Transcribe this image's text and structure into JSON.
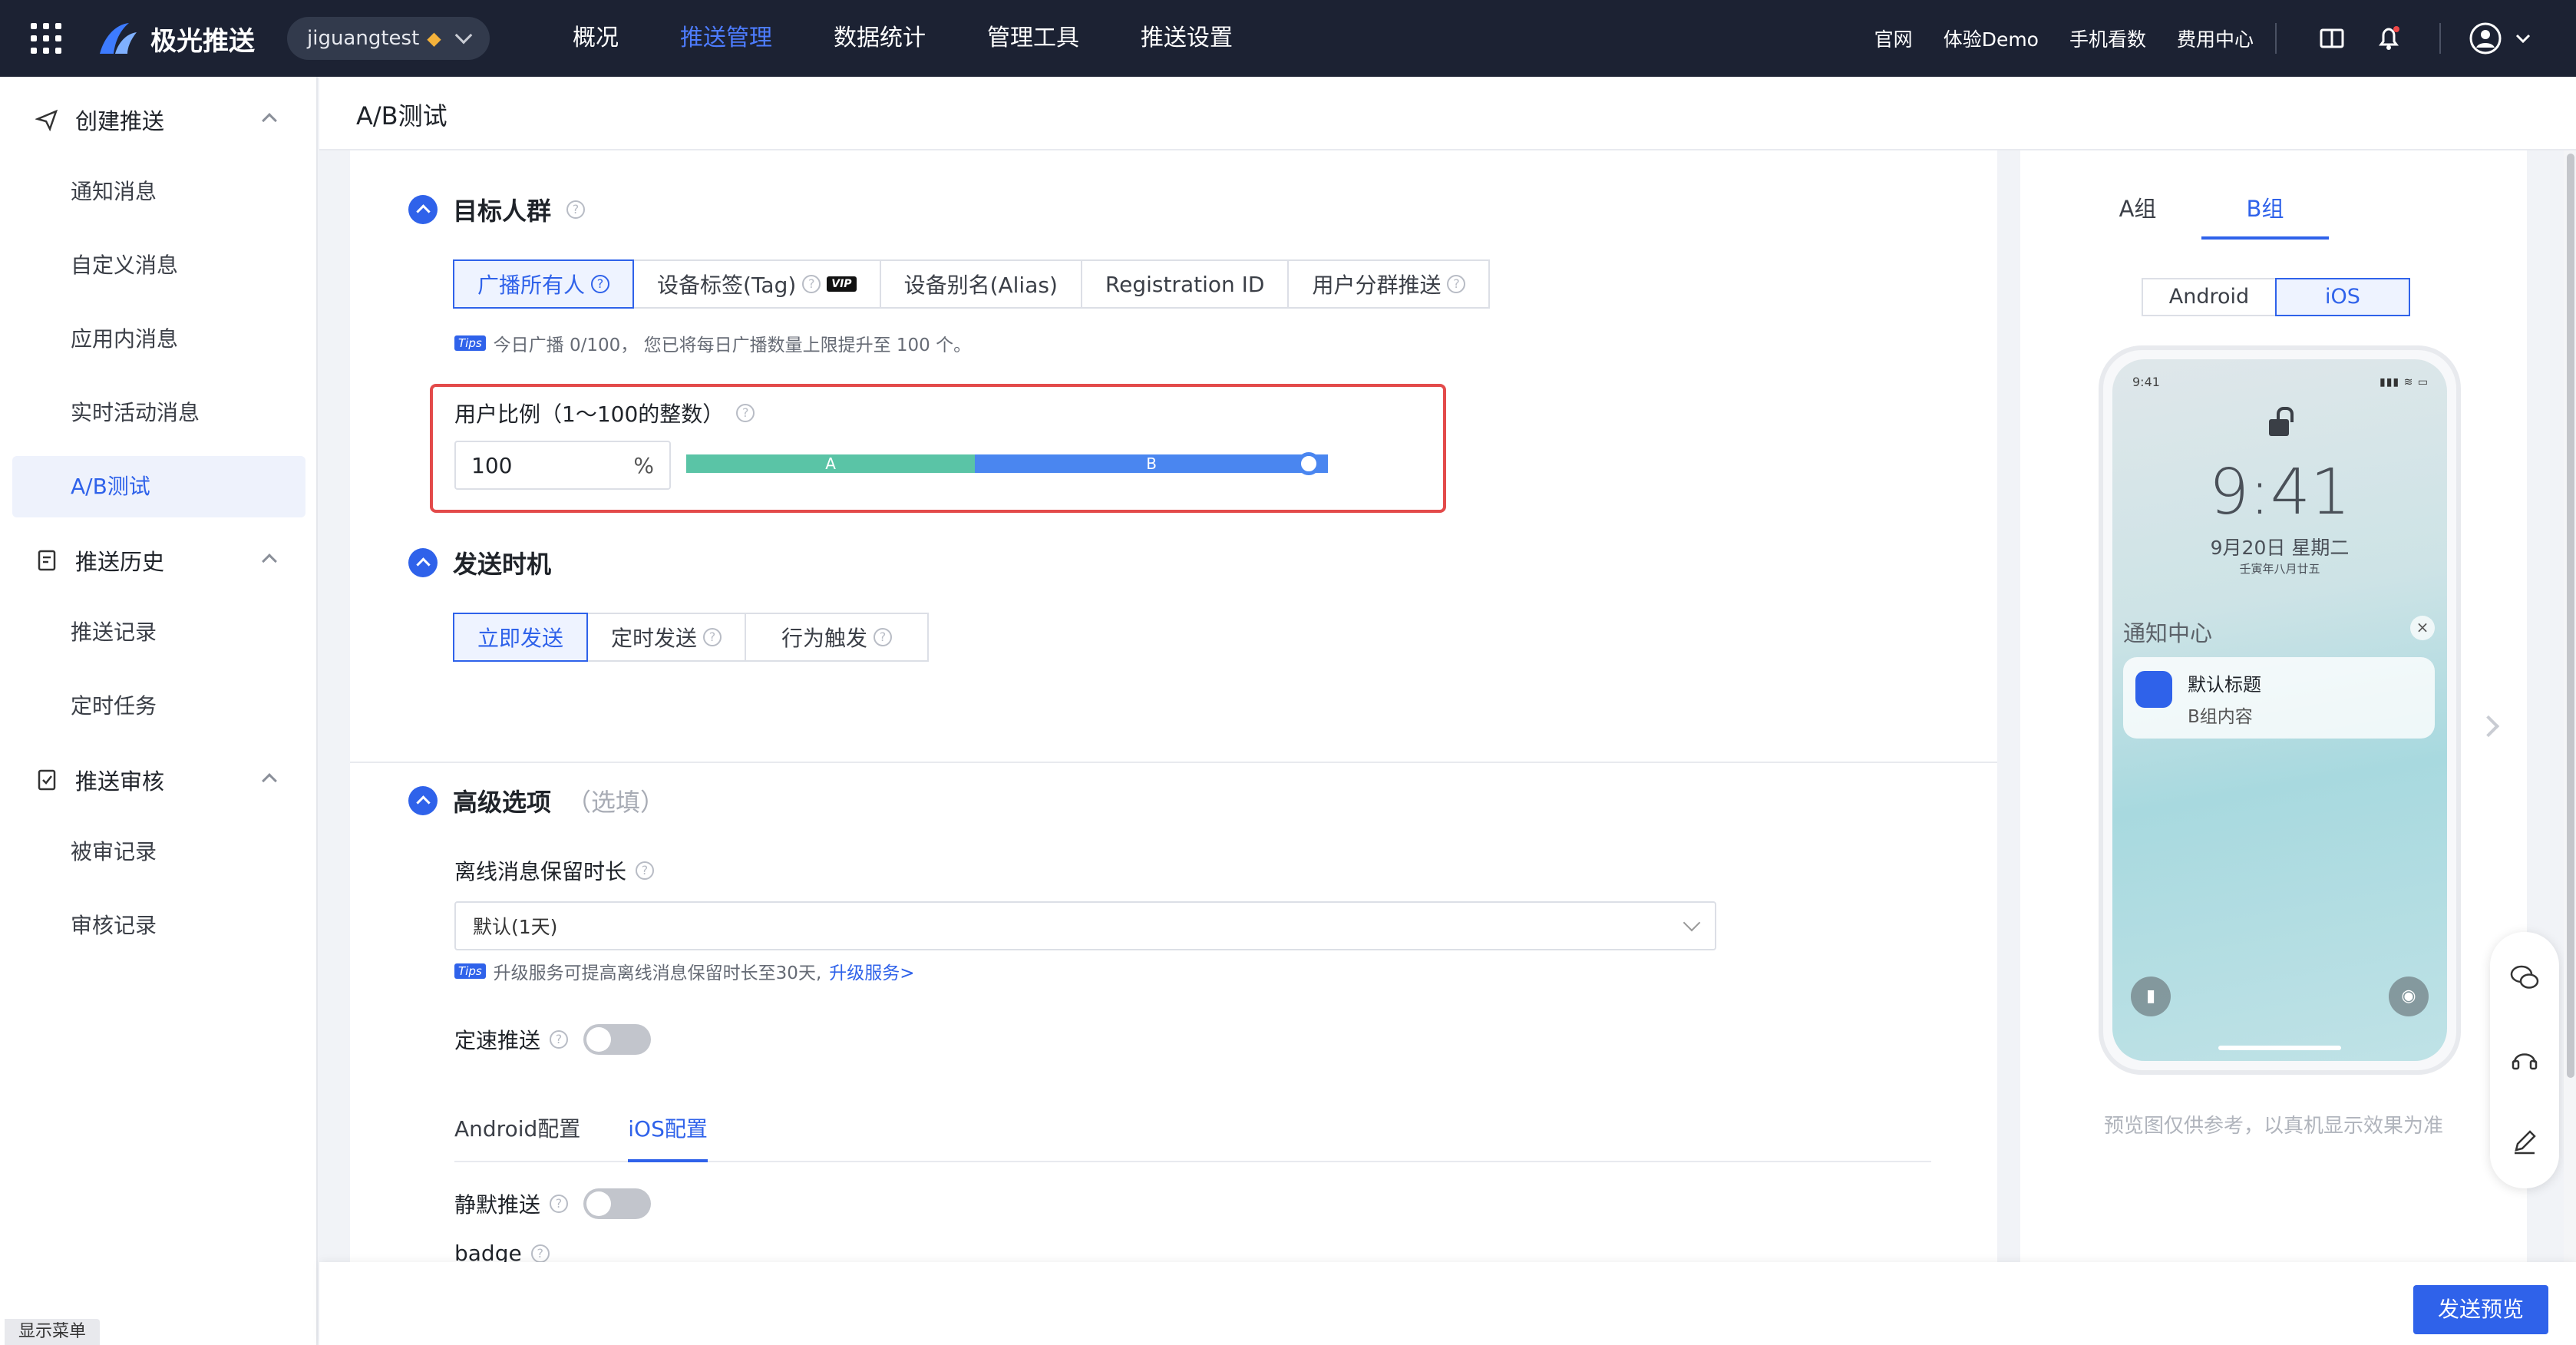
{
  "topbar": {
    "brand": "极光推送",
    "app_name": "jiguangtest",
    "nav": [
      "概况",
      "推送管理",
      "数据统计",
      "管理工具",
      "推送设置"
    ],
    "active_nav": "推送管理",
    "links": [
      "官网",
      "体验Demo",
      "手机看数",
      "费用中心"
    ]
  },
  "sidebar": {
    "groups": [
      {
        "label": "创建推送",
        "items": [
          "通知消息",
          "自定义消息",
          "应用内消息",
          "实时活动消息",
          "A/B测试"
        ]
      },
      {
        "label": "推送历史",
        "items": [
          "推送记录",
          "定时任务"
        ]
      },
      {
        "label": "推送审核",
        "items": [
          "被审记录",
          "审核记录"
        ]
      }
    ],
    "active_item": "A/B测试",
    "show_menu": "显示菜单"
  },
  "page": {
    "title": "A/B测试"
  },
  "target": {
    "heading": "目标人群",
    "options": [
      "广播所有人",
      "设备标签(Tag)",
      "设备别名(Alias)",
      "Registration ID",
      "用户分群推送"
    ],
    "vip_badge": "VIP",
    "tips_badge": "Tips",
    "tips": "今日广播 0/100， 您已将每日广播数量上限提升至 100 个。",
    "ratio_label": "用户比例（1～100的整数）",
    "ratio_value": "100",
    "ratio_unit": "%",
    "ratio_a_label": "A",
    "ratio_b_label": "B",
    "ratio_a_percent": 45,
    "ratio_b_percent": 55
  },
  "timing": {
    "heading": "发送时机",
    "options": [
      "立即发送",
      "定时发送",
      "行为触发"
    ]
  },
  "advanced": {
    "heading": "高级选项",
    "optional": "（选填）",
    "offline_label": "离线消息保留时长",
    "offline_value": "默认(1天)",
    "offline_tip": "升级服务可提高离线消息保留时长至30天,",
    "offline_tip_link": "升级服务>",
    "rate_label": "定速推送",
    "subtabs": [
      "Android配置",
      "iOS配置"
    ],
    "silent_label": "静默推送",
    "badge_label": "badge"
  },
  "preview": {
    "group_tabs": [
      "A组",
      "B组"
    ],
    "platforms": [
      "Android",
      "iOS"
    ],
    "phone_time_small": "9:41",
    "phone_clock": "9:41",
    "phone_date": "9月20日 星期二",
    "phone_lunar": "壬寅年八月廿五",
    "notification_center": "通知中心",
    "notif_title": "默认标题",
    "notif_body": "B组内容",
    "note": "预览图仅供参考，以真机显示效果为准"
  },
  "footer": {
    "send_preview": "发送预览"
  },
  "colors": {
    "primary": "#2f62ea",
    "topbar": "#1c2233",
    "ratio_a": "#5ac4a6",
    "ratio_b": "#4a86f0",
    "highlight": "#e34a4a"
  }
}
